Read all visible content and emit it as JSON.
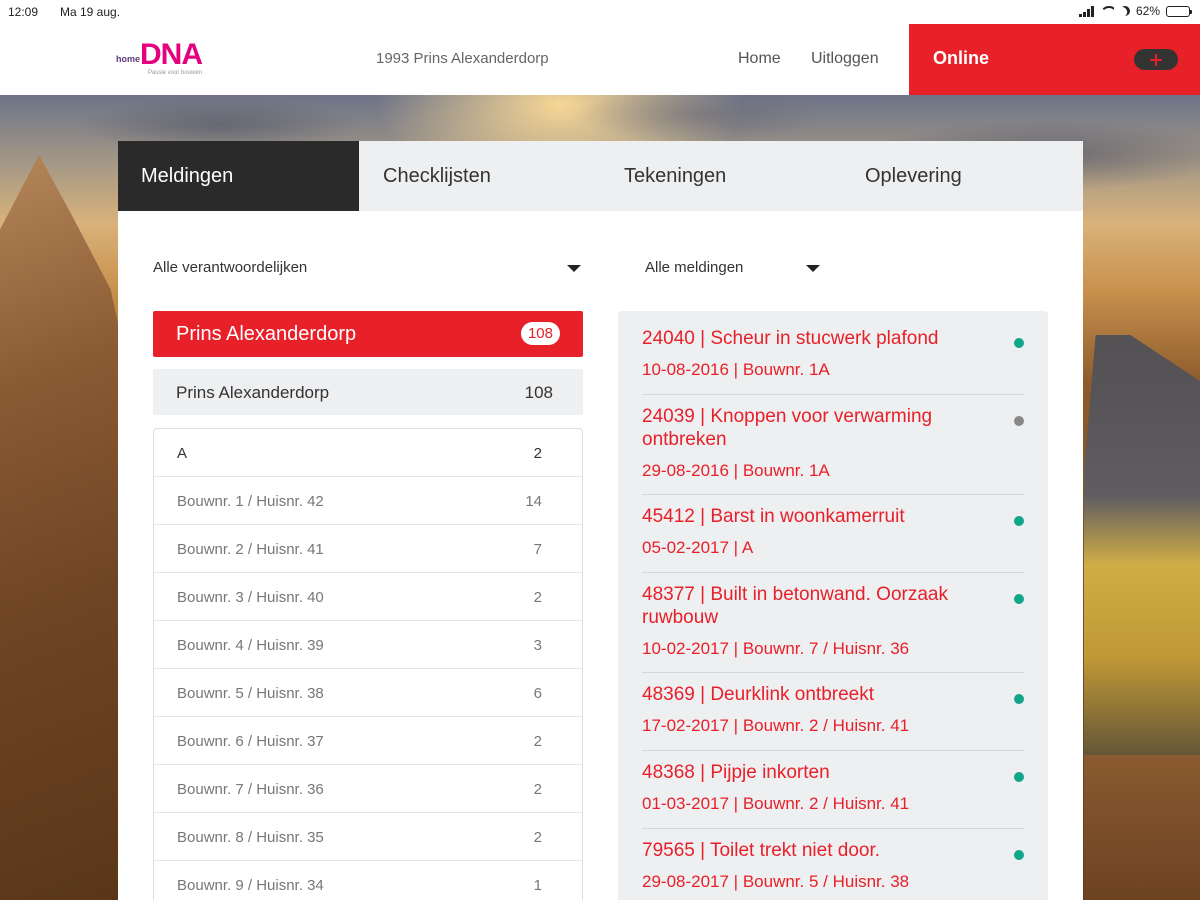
{
  "status_bar": {
    "time": "12:09",
    "date": "Ma 19 aug.",
    "battery": "62%",
    "battery_level": 0.62
  },
  "header": {
    "logo_small": "home",
    "logo_big": "DNA",
    "logo_tagline": "Passie voor bouwen",
    "project": "1993 Prins Alexanderdorp",
    "nav_home": "Home",
    "nav_logout": "Uitloggen",
    "online_label": "Online",
    "plus_icon": "plus-icon"
  },
  "tabs": [
    {
      "label": "Meldingen"
    },
    {
      "label": "Checklijsten"
    },
    {
      "label": "Tekeningen"
    },
    {
      "label": "Oplevering"
    }
  ],
  "filters": {
    "responsible": "Alle verantwoordelijken",
    "messages": "Alle meldingen"
  },
  "project_active": {
    "name": "Prins Alexanderdorp",
    "count": "108"
  },
  "project_sub": {
    "name": "Prins Alexanderdorp",
    "count": "108"
  },
  "units": [
    {
      "name": "A",
      "count": "2"
    },
    {
      "name": "Bouwnr. 1 / Huisnr. 42",
      "count": "14"
    },
    {
      "name": "Bouwnr. 2 / Huisnr. 41",
      "count": "7"
    },
    {
      "name": "Bouwnr. 3 / Huisnr. 40",
      "count": "2"
    },
    {
      "name": "Bouwnr. 4 / Huisnr. 39",
      "count": "3"
    },
    {
      "name": "Bouwnr. 5 / Huisnr. 38",
      "count": "6"
    },
    {
      "name": "Bouwnr. 6 / Huisnr. 37",
      "count": "2"
    },
    {
      "name": "Bouwnr. 7 / Huisnr. 36",
      "count": "2"
    },
    {
      "name": "Bouwnr. 8 / Huisnr. 35",
      "count": "2"
    },
    {
      "name": "Bouwnr. 9 / Huisnr. 34",
      "count": "1"
    }
  ],
  "messages": [
    {
      "title": "24040 | Scheur in stucwerk plafond",
      "meta": "10-08-2016 | Bouwnr. 1A",
      "status_color": "#13a58a"
    },
    {
      "title": "24039 | Knoppen voor verwarming ontbreken",
      "meta": "29-08-2016 | Bouwnr. 1A",
      "status_color": "#888888"
    },
    {
      "title": "45412 | Barst in woonkamerruit",
      "meta": "05-02-2017 | A",
      "status_color": "#13a58a"
    },
    {
      "title": "48377 | Built in betonwand. Oorzaak ruwbouw",
      "meta": "10-02-2017 | Bouwnr. 7 / Huisnr. 36",
      "status_color": "#13a58a"
    },
    {
      "title": "48369 | Deurklink ontbreekt",
      "meta": "17-02-2017 | Bouwnr. 2 / Huisnr. 41",
      "status_color": "#13a58a"
    },
    {
      "title": "48368 | Pijpje inkorten",
      "meta": "01-03-2017 | Bouwnr. 2 / Huisnr. 41",
      "status_color": "#13a58a"
    },
    {
      "title": "79565 | Toilet trekt niet door.",
      "meta": "29-08-2017 | Bouwnr. 5 / Huisnr. 38",
      "status_color": "#13a58a"
    }
  ]
}
